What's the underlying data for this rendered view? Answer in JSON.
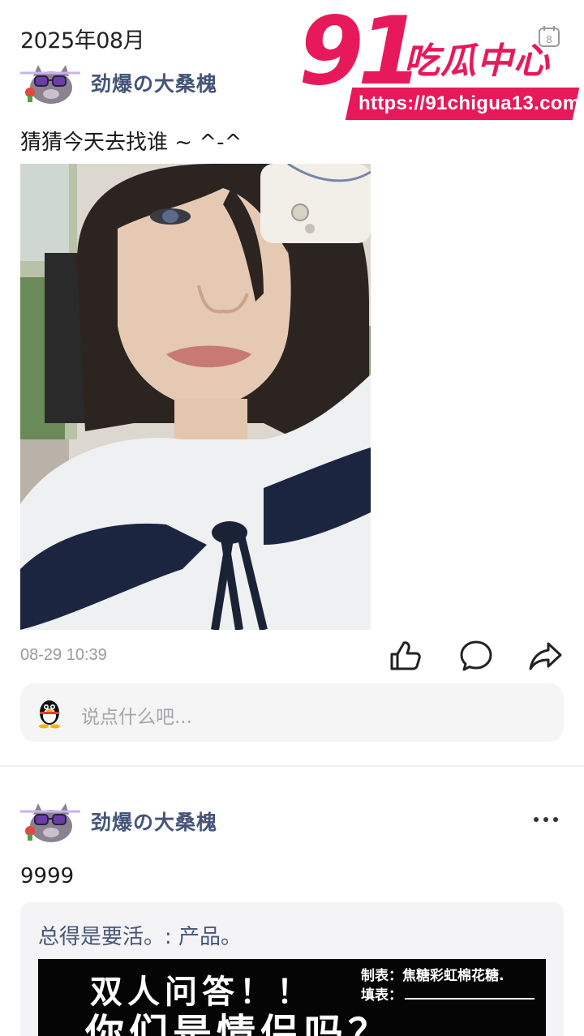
{
  "header": {
    "month": "2025年08月",
    "calendar_day": "8"
  },
  "watermark": {
    "number": "91",
    "name": "吃瓜中心",
    "url": "https://91chigua13.com"
  },
  "posts": [
    {
      "username": "劲爆の大桑槐",
      "text": "猜猜今天去找谁 ~ ^-^",
      "timestamp": "08-29 10:39",
      "comment_placeholder": "说点什么吧..."
    },
    {
      "username": "劲爆の大桑槐",
      "text": "9999",
      "share": {
        "title": "总得是要活。: 产品。",
        "image_title": "双人问答！！",
        "image_maker": "制表：焦糖彩虹棉花糖.",
        "image_filler": "填表：",
        "image_subtitle": "你们是情侣吗？"
      }
    }
  ],
  "colors": {
    "accent": "#e8195a",
    "username": "#455579",
    "muted": "#9a9a9a"
  },
  "icons": {
    "calendar": "calendar-icon",
    "like": "thumbs-up-icon",
    "comment": "comment-bubble-icon",
    "share": "share-arrow-icon",
    "more": "more-dots-icon",
    "qq": "qq-penguin-icon"
  }
}
